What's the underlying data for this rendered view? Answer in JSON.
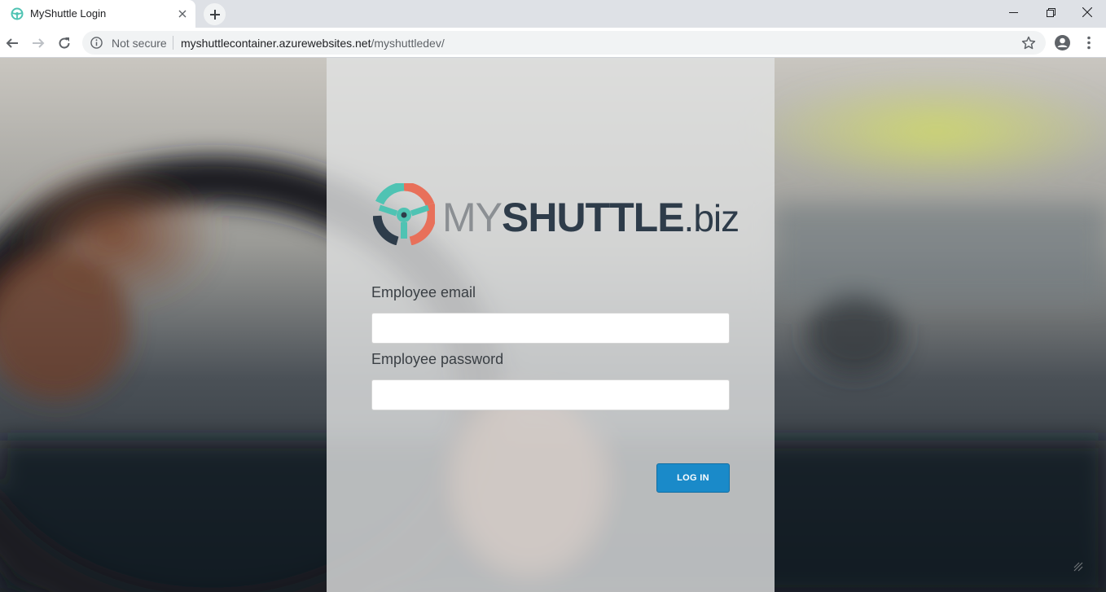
{
  "browser": {
    "tab_title": "MyShuttle Login",
    "security_label": "Not secure",
    "url_host": "myshuttlecontainer.azurewebsites.net",
    "url_path": "/myshuttledev/"
  },
  "logo": {
    "my": "MY",
    "shuttle": "SHUTTLE",
    "biz": ".biz"
  },
  "form": {
    "email_label": "Employee email",
    "email_value": "",
    "password_label": "Employee password",
    "password_value": "",
    "login_button": "LOG IN"
  },
  "colors": {
    "accent": "#1a8ac9",
    "logo_teal": "#4fc3b3",
    "logo_coral": "#e8705a",
    "logo_dark": "#2e3c4a"
  }
}
